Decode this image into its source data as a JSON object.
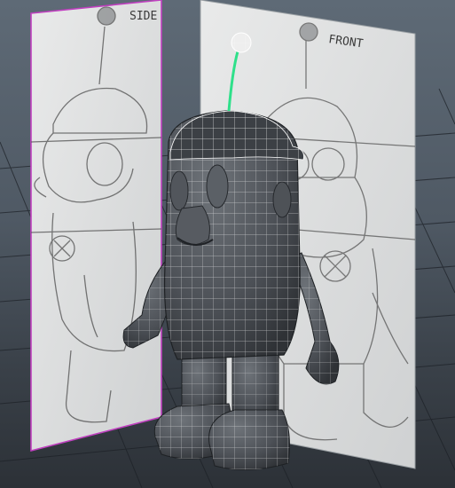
{
  "viewport": {
    "camera": "persp",
    "selection_highlight_color": "#2ee08a",
    "plane_border_color": "#c040c0",
    "grid_color": "#1c2026"
  },
  "image_planes": [
    {
      "name": "side",
      "label": "SIDE"
    },
    {
      "name": "front",
      "label": "FRONT"
    }
  ],
  "model": {
    "type": "character-mesh",
    "display": "wireframe-on-shaded",
    "selected": "antenna"
  }
}
